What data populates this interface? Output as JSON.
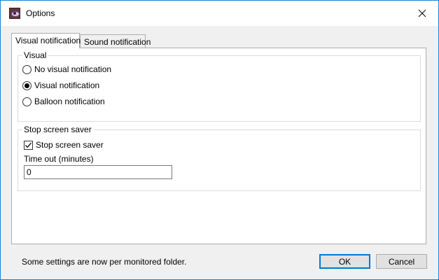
{
  "window": {
    "title": "Options"
  },
  "tabs": [
    {
      "label": "Visual notification",
      "selected": true
    },
    {
      "label": "Sound notification",
      "selected": false
    }
  ],
  "visual_group": {
    "legend": "Visual",
    "options": [
      {
        "label": "No visual notification",
        "checked": false
      },
      {
        "label": "Visual notification",
        "checked": true
      },
      {
        "label": "Balloon notification",
        "checked": false
      }
    ]
  },
  "saver_group": {
    "legend": "Stop screen saver",
    "checkbox_label": "Stop screen saver",
    "checkbox_checked": true,
    "timeout_label": "Time out (minutes)",
    "timeout_value": "0"
  },
  "footer": {
    "status": "Some settings are now per monitored folder.",
    "ok_label": "OK",
    "cancel_label": "Cancel"
  },
  "colors": {
    "accent": "#0078d7",
    "window_border": "#1883d7"
  },
  "icons": {
    "close": "close-icon",
    "app": "app-eye-icon"
  }
}
